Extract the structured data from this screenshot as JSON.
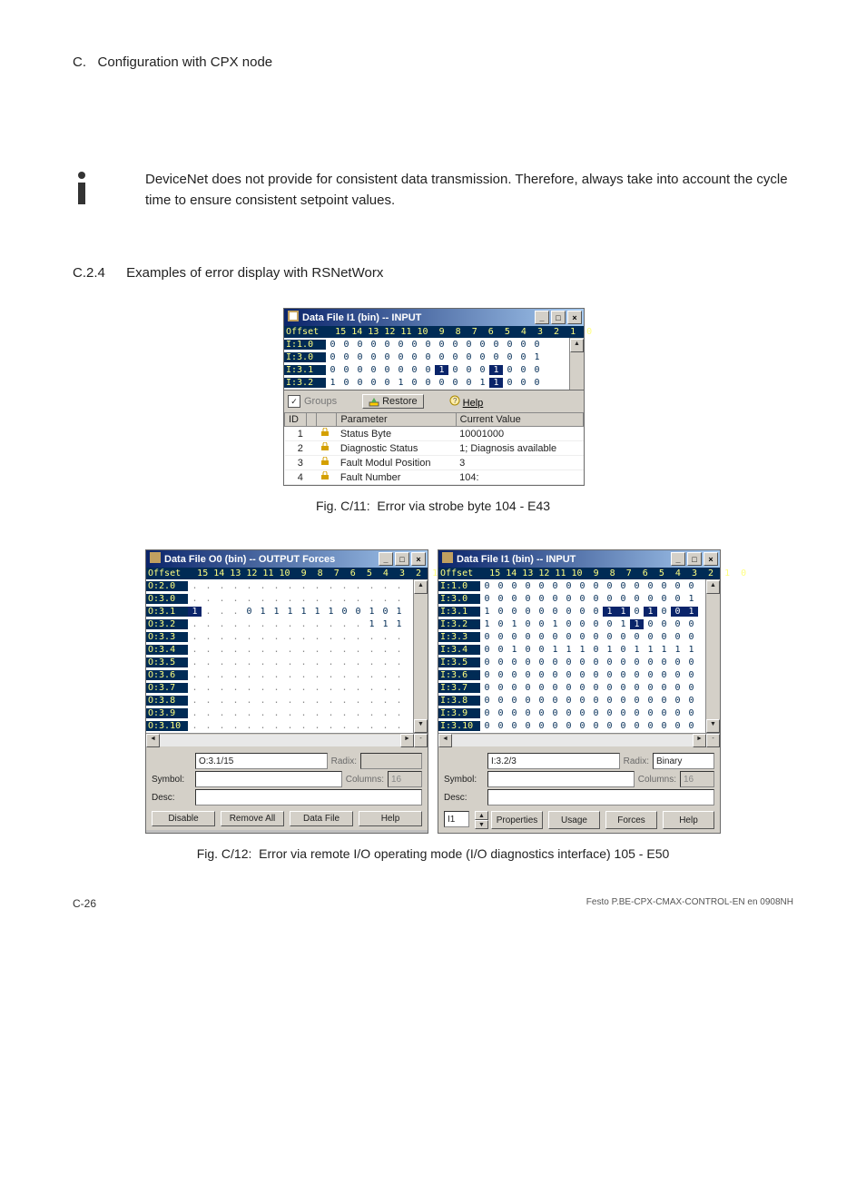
{
  "appendix": "C.",
  "appendix_title": "Configuration with CPX node",
  "info_text": "DeviceNet does not provide for consistent data transmission. Therefore, always take into account the cycle time to ensure consistent setpoint values.",
  "section_num": "C.2.4",
  "section_title": "Examples of error display with RSNetWorx",
  "fig11_caption": "Fig. C/11:  Error via strobe byte 104 - E43",
  "fig12_caption": "Fig. C/12:  Error via remote I/O operating mode (I/O diagnostics interface) 105 - E50",
  "page_number": "C-26",
  "doc_footer": "Festo  P.BE-CPX-CMAX-CONTROL-EN  en 0908NH",
  "win_input_title": "Data File I1 (bin)  --  INPUT",
  "win_output_title": "Data File O0 (bin)  --  OUTPUT Forces",
  "bits_header": "Offset   15 14 13 12 11 10  9  8  7  6  5  4  3  2  1  0",
  "fig11_rows": [
    {
      "off": "I:1.0",
      "b": [
        0,
        0,
        0,
        0,
        0,
        0,
        0,
        0,
        0,
        0,
        0,
        0,
        0,
        0,
        0,
        0
      ],
      "sel": []
    },
    {
      "off": "I:3.0",
      "b": [
        0,
        0,
        0,
        0,
        0,
        0,
        0,
        0,
        0,
        0,
        0,
        0,
        0,
        0,
        0,
        1
      ],
      "sel": []
    },
    {
      "off": "I:3.1",
      "b": [
        0,
        0,
        0,
        0,
        0,
        0,
        0,
        0,
        1,
        0,
        0,
        0,
        1,
        0,
        0,
        0
      ],
      "sel": [
        7,
        3
      ]
    },
    {
      "off": "I:3.2",
      "b": [
        1,
        0,
        0,
        0,
        0,
        1,
        0,
        0,
        0,
        0,
        0,
        1,
        1,
        0,
        0,
        0
      ],
      "sel": [
        3
      ]
    }
  ],
  "toolbar": {
    "groups": "Groups",
    "restore": "Restore",
    "help": "Help"
  },
  "param_headers": [
    "ID",
    "",
    "",
    "Parameter",
    "Current Value"
  ],
  "param_rows": [
    {
      "id": "1",
      "p": "Status Byte",
      "v": "10001000"
    },
    {
      "id": "2",
      "p": "Diagnostic Status",
      "v": "1; Diagnosis available"
    },
    {
      "id": "3",
      "p": "Fault Modul Position",
      "v": "3"
    },
    {
      "id": "4",
      "p": "Fault Number",
      "v": "104:"
    }
  ],
  "out_rows": [
    {
      "off": "O:2.0",
      "b": [
        ".",
        ".",
        ".",
        ".",
        ".",
        ".",
        ".",
        ".",
        ".",
        ".",
        ".",
        ".",
        ".",
        ".",
        ".",
        "."
      ]
    },
    {
      "off": "O:3.0",
      "b": [
        ".",
        ".",
        ".",
        ".",
        ".",
        ".",
        ".",
        ".",
        ".",
        ".",
        ".",
        ".",
        ".",
        ".",
        ".",
        "."
      ]
    },
    {
      "off": "O:3.1",
      "b": [
        "1",
        ".",
        ".",
        ".",
        "0",
        "1",
        "1",
        "1",
        "1",
        "1",
        "1",
        "0",
        "0",
        "1",
        "0",
        "1"
      ],
      "sel": [
        15
      ]
    },
    {
      "off": "O:3.2",
      "b": [
        ".",
        ".",
        ".",
        ".",
        ".",
        ".",
        ".",
        ".",
        ".",
        ".",
        ".",
        ".",
        ".",
        "1",
        "1",
        "1"
      ]
    },
    {
      "off": "O:3.3",
      "b": [
        ".",
        ".",
        ".",
        ".",
        ".",
        ".",
        ".",
        ".",
        ".",
        ".",
        ".",
        ".",
        ".",
        ".",
        ".",
        "."
      ]
    },
    {
      "off": "O:3.4",
      "b": [
        ".",
        ".",
        ".",
        ".",
        ".",
        ".",
        ".",
        ".",
        ".",
        ".",
        ".",
        ".",
        ".",
        ".",
        ".",
        "."
      ]
    },
    {
      "off": "O:3.5",
      "b": [
        ".",
        ".",
        ".",
        ".",
        ".",
        ".",
        ".",
        ".",
        ".",
        ".",
        ".",
        ".",
        ".",
        ".",
        ".",
        "."
      ]
    },
    {
      "off": "O:3.6",
      "b": [
        ".",
        ".",
        ".",
        ".",
        ".",
        ".",
        ".",
        ".",
        ".",
        ".",
        ".",
        ".",
        ".",
        ".",
        ".",
        "."
      ]
    },
    {
      "off": "O:3.7",
      "b": [
        ".",
        ".",
        ".",
        ".",
        ".",
        ".",
        ".",
        ".",
        ".",
        ".",
        ".",
        ".",
        ".",
        ".",
        ".",
        "."
      ]
    },
    {
      "off": "O:3.8",
      "b": [
        ".",
        ".",
        ".",
        ".",
        ".",
        ".",
        ".",
        ".",
        ".",
        ".",
        ".",
        ".",
        ".",
        ".",
        ".",
        "."
      ]
    },
    {
      "off": "O:3.9",
      "b": [
        ".",
        ".",
        ".",
        ".",
        ".",
        ".",
        ".",
        ".",
        ".",
        ".",
        ".",
        ".",
        ".",
        ".",
        ".",
        "."
      ]
    },
    {
      "off": "O:3.10",
      "b": [
        ".",
        ".",
        ".",
        ".",
        ".",
        ".",
        ".",
        ".",
        ".",
        ".",
        ".",
        ".",
        ".",
        ".",
        ".",
        "."
      ]
    }
  ],
  "in_rows": [
    {
      "off": "I:1.0",
      "b": [
        0,
        0,
        0,
        0,
        0,
        0,
        0,
        0,
        0,
        0,
        0,
        0,
        0,
        0,
        0,
        0
      ]
    },
    {
      "off": "I:3.0",
      "b": [
        0,
        0,
        0,
        0,
        0,
        0,
        0,
        0,
        0,
        0,
        0,
        0,
        0,
        0,
        0,
        1
      ]
    },
    {
      "off": "I:3.1",
      "b": [
        1,
        0,
        0,
        0,
        0,
        0,
        0,
        0,
        0,
        1,
        1,
        0,
        1,
        0,
        0,
        1
      ],
      "sel": [
        6,
        5,
        3,
        0,
        1
      ]
    },
    {
      "off": "I:3.2",
      "b": [
        1,
        0,
        1,
        0,
        0,
        1,
        0,
        0,
        0,
        0,
        1,
        1,
        0,
        0,
        0,
        0
      ],
      "sel": [
        4
      ]
    },
    {
      "off": "I:3.3",
      "b": [
        0,
        0,
        0,
        0,
        0,
        0,
        0,
        0,
        0,
        0,
        0,
        0,
        0,
        0,
        0,
        0
      ]
    },
    {
      "off": "I:3.4",
      "b": [
        0,
        0,
        1,
        0,
        0,
        1,
        1,
        1,
        0,
        1,
        0,
        1,
        1,
        1,
        1,
        1
      ]
    },
    {
      "off": "I:3.5",
      "b": [
        0,
        0,
        0,
        0,
        0,
        0,
        0,
        0,
        0,
        0,
        0,
        0,
        0,
        0,
        0,
        0
      ]
    },
    {
      "off": "I:3.6",
      "b": [
        0,
        0,
        0,
        0,
        0,
        0,
        0,
        0,
        0,
        0,
        0,
        0,
        0,
        0,
        0,
        0
      ]
    },
    {
      "off": "I:3.7",
      "b": [
        0,
        0,
        0,
        0,
        0,
        0,
        0,
        0,
        0,
        0,
        0,
        0,
        0,
        0,
        0,
        0
      ]
    },
    {
      "off": "I:3.8",
      "b": [
        0,
        0,
        0,
        0,
        0,
        0,
        0,
        0,
        0,
        0,
        0,
        0,
        0,
        0,
        0,
        0
      ]
    },
    {
      "off": "I:3.9",
      "b": [
        0,
        0,
        0,
        0,
        0,
        0,
        0,
        0,
        0,
        0,
        0,
        0,
        0,
        0,
        0,
        0
      ]
    },
    {
      "off": "I:3.10",
      "b": [
        0,
        0,
        0,
        0,
        0,
        0,
        0,
        0,
        0,
        0,
        0,
        0,
        0,
        0,
        0,
        0
      ]
    }
  ],
  "out_fields": {
    "addr": "O:3.1/15",
    "radix_label": "Radix:",
    "radix": "",
    "symbol_label": "Symbol:",
    "symbol": "",
    "columns_label": "Columns:",
    "columns": "16",
    "desc_label": "Desc:"
  },
  "in_fields": {
    "addr": "I:3.2/3",
    "radix_label": "Radix:",
    "radix": "Binary",
    "symbol_label": "Symbol:",
    "symbol": "",
    "columns_label": "Columns:",
    "columns": "16",
    "desc_label": "Desc:"
  },
  "out_buttons": [
    "Disable",
    "Remove All",
    "Data File",
    "Help"
  ],
  "in_buttons": [
    "Properties",
    "Usage",
    "Forces",
    "Help"
  ],
  "in_prefix": "I1"
}
